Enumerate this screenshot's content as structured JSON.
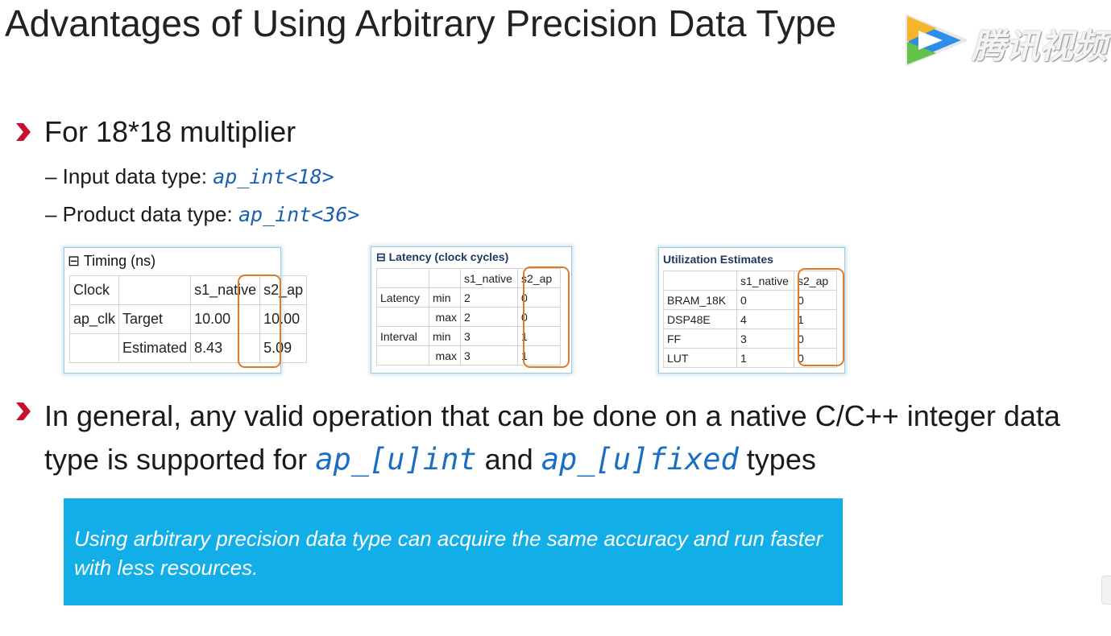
{
  "slide": {
    "title": "Advantages of Using Arbitrary Precision Data Type",
    "watermark": "腾讯视频",
    "bullet1": "For 18*18 multiplier",
    "sub1_label": "– Input data type: ",
    "sub1_code": "ap_int<18>",
    "sub2_label": "– Product data type: ",
    "sub2_code": "ap_int<36>",
    "bullet2_part1": "In general, any valid operation that can be done on a native C/C++ integer data type is supported for ",
    "bullet2_code1": "ap_[u]int",
    "bullet2_part2": " and ",
    "bullet2_code2": "ap_[u]fixed",
    "bullet2_part3": " types",
    "note": "Using arbitrary precision data type can acquire the same accuracy and run faster with less resources."
  },
  "timing": {
    "title": "Timing (ns)",
    "collapse": "⊟",
    "rows": [
      [
        "Clock",
        "",
        "s1_native",
        "s2_ap"
      ],
      [
        "ap_clk",
        "Target",
        "10.00",
        "10.00"
      ],
      [
        "",
        "Estimated",
        "8.43",
        "5.09"
      ]
    ]
  },
  "latency": {
    "title": "Latency (clock cycles)",
    "collapse": "⊟",
    "rows": [
      [
        "",
        "",
        "s1_native",
        "s2_ap"
      ],
      [
        "Latency",
        "min",
        "2",
        "0"
      ],
      [
        "",
        "max",
        "2",
        "0"
      ],
      [
        "Interval",
        "min",
        "3",
        "1"
      ],
      [
        "",
        "max",
        "3",
        "1"
      ]
    ]
  },
  "utilization": {
    "title": "Utilization Estimates",
    "rows": [
      [
        "",
        "s1_native",
        "s2_ap"
      ],
      [
        "BRAM_18K",
        "0",
        "0"
      ],
      [
        "DSP48E",
        "4",
        "1"
      ],
      [
        "FF",
        "3",
        "0"
      ],
      [
        "LUT",
        "1",
        "0"
      ]
    ]
  },
  "colors": {
    "accent_red": "#c8102e",
    "code_blue": "#1a5fb4",
    "highlight_orange": "#e07b24",
    "note_bg": "#12aee8"
  }
}
